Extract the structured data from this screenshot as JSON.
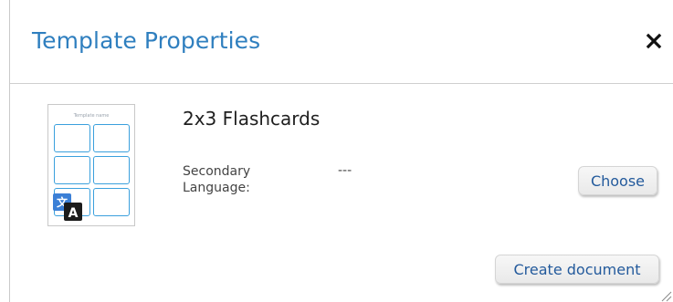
{
  "dialog": {
    "title": "Template Properties",
    "close_icon": "close-icon"
  },
  "template": {
    "name": "2x3 Flashcards",
    "thumbnail_title": "Template name",
    "badge_icon": "translate-icon",
    "secondary_language_label": "Secondary Language:",
    "secondary_language_value": "---"
  },
  "buttons": {
    "choose_label": "Choose",
    "create_label": "Create document"
  },
  "colors": {
    "title": "#2f7fbf",
    "button_text": "#235a9c",
    "card_border": "#3aa0dd"
  }
}
